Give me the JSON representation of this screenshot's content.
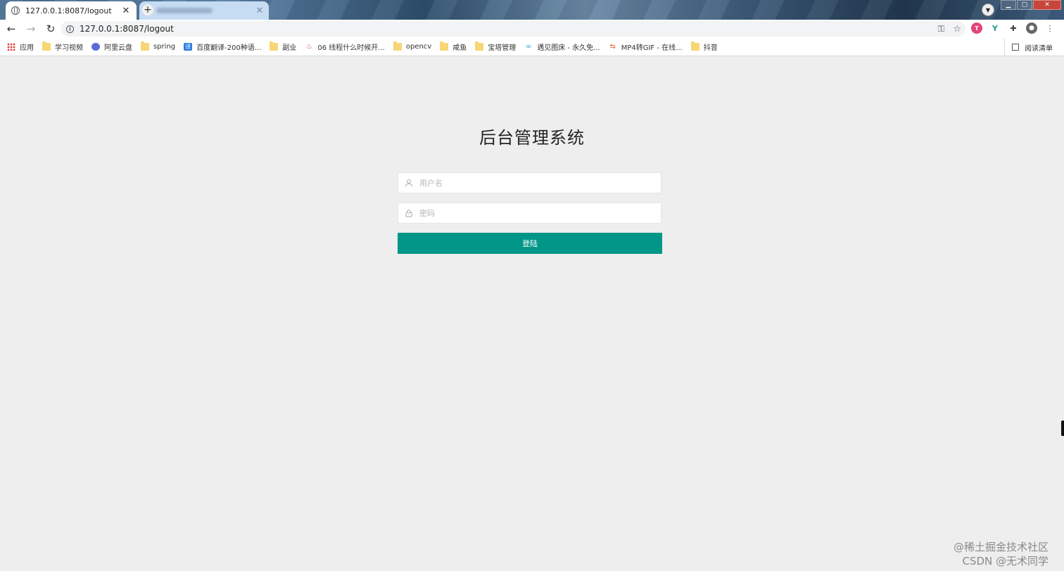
{
  "browser": {
    "active_tab_title": "127.0.0.1:8087/logout",
    "url": "127.0.0.1:8087/logout",
    "bookmarks": [
      {
        "label": "应用",
        "icon": "apps-icon"
      },
      {
        "label": "学习视频",
        "icon": "folder-icon"
      },
      {
        "label": "阿里云盘",
        "icon": "aliyun-icon"
      },
      {
        "label": "spring",
        "icon": "folder-icon"
      },
      {
        "label": "百度翻译-200种语...",
        "icon": "translate-icon"
      },
      {
        "label": "副业",
        "icon": "folder-icon"
      },
      {
        "label": "06 线程什么时候开...",
        "icon": "fire-icon"
      },
      {
        "label": "opencv",
        "icon": "folder-icon"
      },
      {
        "label": "咸鱼",
        "icon": "folder-icon"
      },
      {
        "label": "宝塔管理",
        "icon": "folder-icon"
      },
      {
        "label": "遇见图床 - 永久免...",
        "icon": "link-icon"
      },
      {
        "label": "MP4转GIF - 在线...",
        "icon": "gif-icon"
      },
      {
        "label": "抖音",
        "icon": "folder-icon"
      }
    ],
    "reading_list": "阅读清单"
  },
  "login": {
    "title": "后台管理系统",
    "username_placeholder": "用户名",
    "password_placeholder": "密码",
    "submit_label": "登陆",
    "accent_color": "#009688"
  },
  "watermark": {
    "line1": "@稀土掘金技术社区",
    "line2": "CSDN @无术同学"
  }
}
